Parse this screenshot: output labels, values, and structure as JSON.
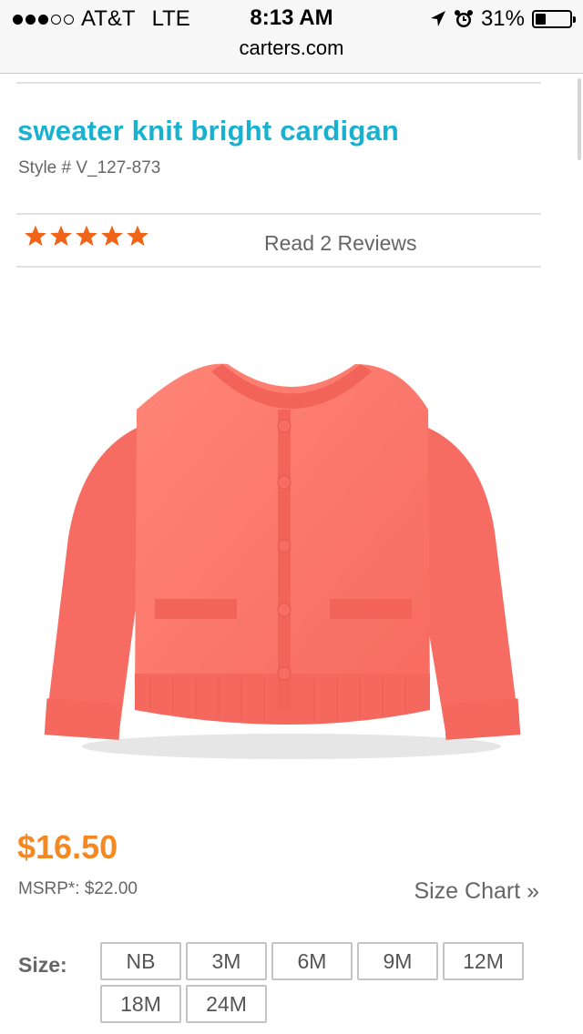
{
  "status_bar": {
    "carrier": "AT&T",
    "network": "LTE",
    "time": "8:13 AM",
    "battery_percent_label": "31%",
    "battery_level": 0.31,
    "signal_bars_filled": 3,
    "signal_bars_total": 5
  },
  "browser": {
    "url": "carters.com"
  },
  "product": {
    "title": "sweater knit bright cardigan",
    "style": "Style # V_127-873",
    "rating": 5,
    "rating_max": 5,
    "reviews_link": "Read 2 Reviews",
    "price": "$16.50",
    "msrp": "MSRP*: $22.00",
    "size_chart_link": "Size Chart »",
    "size_label": "Size:",
    "sizes": [
      "NB",
      "3M",
      "6M",
      "9M",
      "12M",
      "18M",
      "24M"
    ]
  },
  "colors": {
    "title": "#19b1d0",
    "price": "#f5891f",
    "star": "#f0641a",
    "product": "#ff7a6e"
  },
  "icons": [
    "location-arrow-icon",
    "alarm-clock-icon",
    "battery-icon",
    "star-icon"
  ]
}
